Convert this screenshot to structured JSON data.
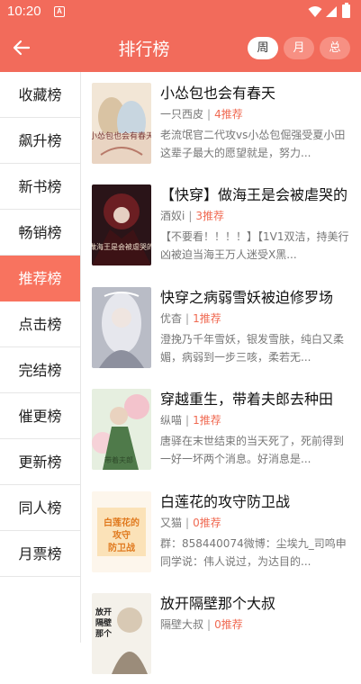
{
  "status_bar": {
    "time": "10:20",
    "notification_icon": "A"
  },
  "header": {
    "title": "排行榜",
    "periods": [
      {
        "label": "周",
        "active": true
      },
      {
        "label": "月",
        "active": false
      },
      {
        "label": "总",
        "active": false
      }
    ]
  },
  "sidebar": {
    "items": [
      {
        "label": "收藏榜",
        "active": false
      },
      {
        "label": "飙升榜",
        "active": false
      },
      {
        "label": "新书榜",
        "active": false
      },
      {
        "label": "畅销榜",
        "active": false
      },
      {
        "label": "推荐榜",
        "active": true
      },
      {
        "label": "点击榜",
        "active": false
      },
      {
        "label": "完结榜",
        "active": false
      },
      {
        "label": "催更榜",
        "active": false
      },
      {
        "label": "更新榜",
        "active": false
      },
      {
        "label": "同人榜",
        "active": false
      },
      {
        "label": "月票榜",
        "active": false
      }
    ]
  },
  "books": [
    {
      "title": "小怂包也会有春天",
      "author": "一只西皮",
      "recommend": "4推荐",
      "desc": "老流氓官二代攻vs小怂包倔强受夏小田这辈子最大的愿望就是，努力...",
      "cover_text": "小怂包也会有春天"
    },
    {
      "title": "【快穿】做海王是会被虐哭的",
      "author": "酒奴i",
      "recommend": "3推荐",
      "desc": "【不要看！！！！】【1V1双洁，持美行凶被迫当海王万人迷受X黑...",
      "cover_text": "做海王是会被虐哭的"
    },
    {
      "title": "快穿之病弱雪妖被迫修罗场",
      "author": "优杳",
      "recommend": "1推荐",
      "desc": "澄挽乃千年雪妖，银发雪肤，纯白又柔媚，病弱到一步三咳，柔若无...",
      "cover_text": ""
    },
    {
      "title": "穿越重生，带着夫郎去种田",
      "author": "纵喵",
      "recommend": "1推荐",
      "desc": "唐驿在末世结束的当天死了，死前得到一好一坏两个消息。好消息是...",
      "cover_text": "带着夫郎"
    },
    {
      "title": "白莲花的攻守防卫战",
      "author": "又猫",
      "recommend": "0推荐",
      "desc": "群：858440074微博：尘埃九_司鸣申同学说：伟人说过，为达目的...",
      "cover_text": "白莲花的攻守防卫战"
    },
    {
      "title": "放开隔壁那个大叔",
      "author": "隔壁大叔",
      "recommend": "0推荐",
      "desc": "",
      "cover_text": "放开隔壁那个大叔"
    }
  ]
}
